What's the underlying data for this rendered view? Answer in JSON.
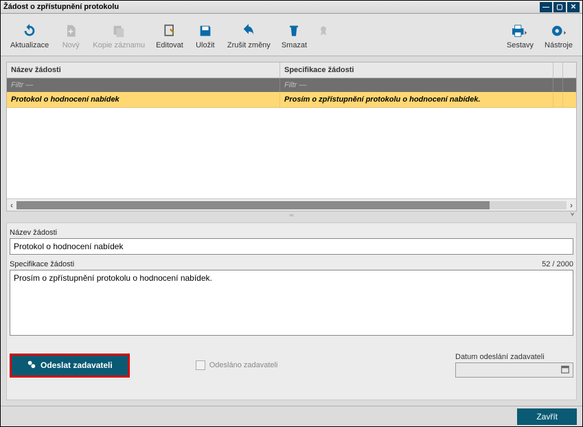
{
  "window": {
    "title": "Žádost o zpřístupnění protokolu"
  },
  "toolbar": {
    "refresh": "Aktualizace",
    "new": "Nový",
    "copy": "Kopie záznamu",
    "edit": "Editovat",
    "save": "Uložit",
    "undo": "Zrušit změny",
    "delete": "Smazat",
    "reports": "Sestavy",
    "tools": "Nástroje"
  },
  "grid": {
    "headers": {
      "name": "Název žádosti",
      "spec": "Specifikace žádosti"
    },
    "filter_placeholder": "Filtr —",
    "rows": [
      {
        "name": "Protokol o hodnocení nabídek",
        "spec": "Prosím o zpřístupnění protokolu o hodnocení nabídek."
      }
    ]
  },
  "form": {
    "name_label": "Název žádosti",
    "name_value": "Protokol o hodnocení nabídek",
    "spec_label": "Specifikace žádosti",
    "spec_value": "Prosím o zpřístupnění protokolu o hodnocení nabídek.",
    "counter": "52 / 2000",
    "send_button": "Odeslat zadavateli",
    "sent_checkbox": "Odesláno zadavateli",
    "date_label": "Datum odeslání zadavateli",
    "date_value": ""
  },
  "footer": {
    "close": "Zavřít"
  }
}
